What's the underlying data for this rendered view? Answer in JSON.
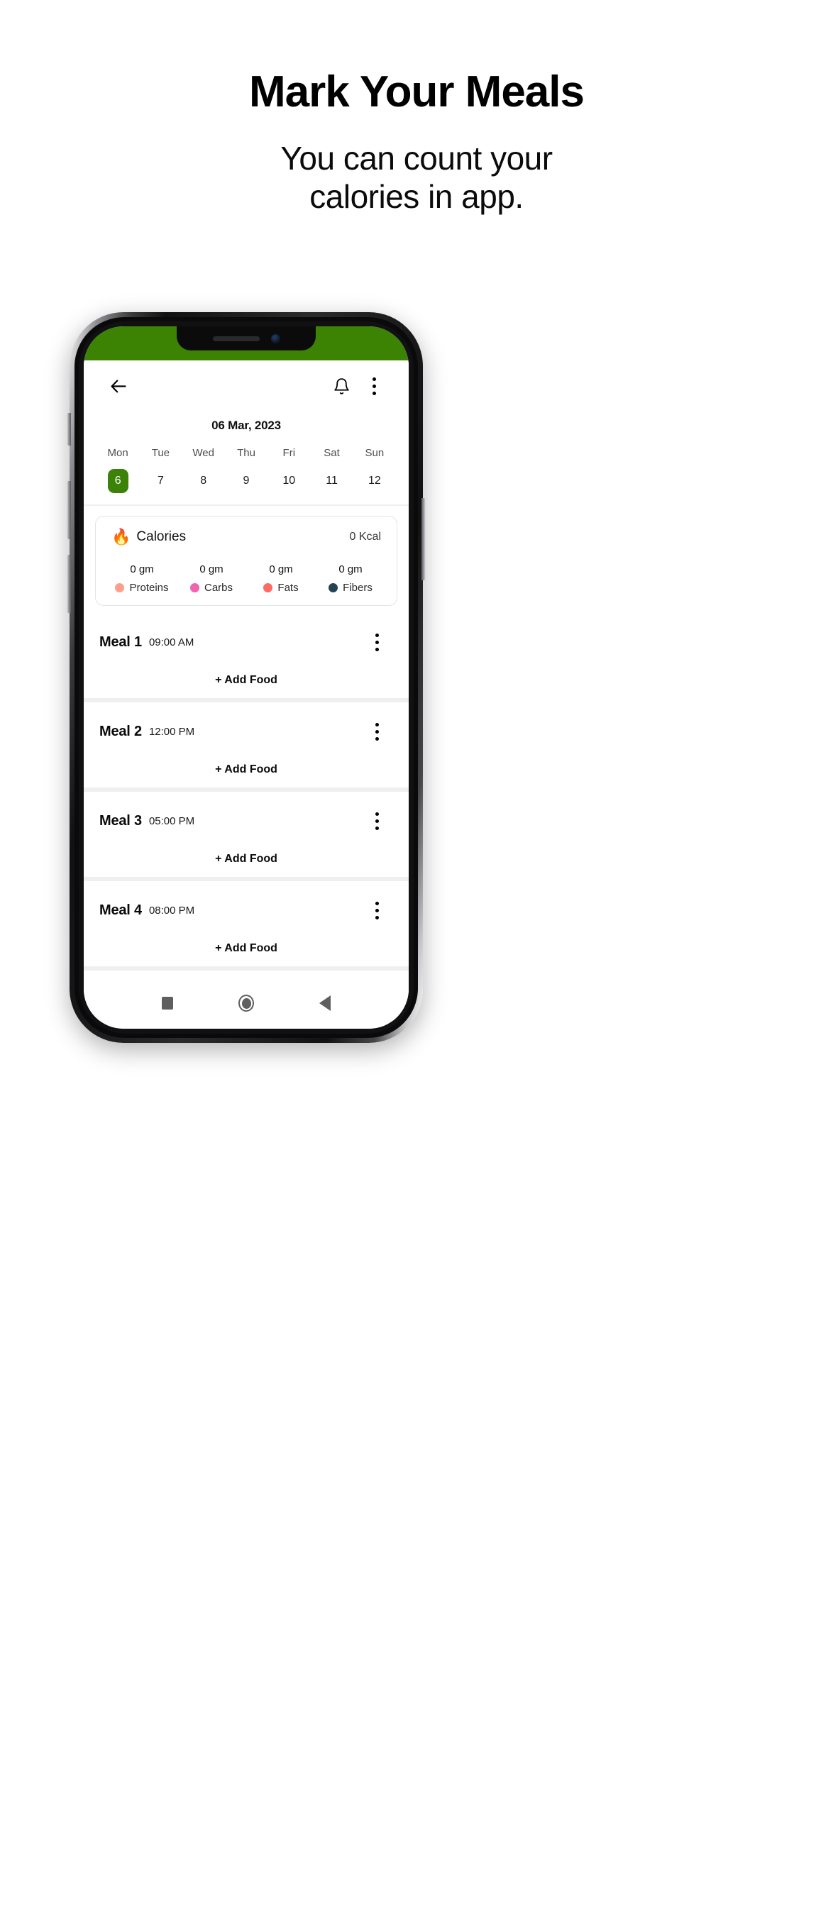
{
  "promo": {
    "title": "Mark Your Meals",
    "subtitle_line1": "You can count your",
    "subtitle_line2": "calories in app."
  },
  "phone": {
    "status_bar_color": "#3d8303"
  },
  "app_bar": {
    "back_icon": "arrow-left-icon",
    "notification_icon": "bell-icon",
    "overflow_icon": "more-vertical-icon"
  },
  "calendar": {
    "selected_date_label": "06 Mar, 2023",
    "weekdays": [
      "Mon",
      "Tue",
      "Wed",
      "Thu",
      "Fri",
      "Sat",
      "Sun"
    ],
    "dates": [
      "6",
      "7",
      "8",
      "9",
      "10",
      "11",
      "12"
    ],
    "selected_index": 0,
    "selected_color": "#3c8209"
  },
  "calories_card": {
    "icon": "fire-emoji",
    "icon_glyph": "🔥",
    "label": "Calories",
    "value": "0 Kcal",
    "macros": [
      {
        "amount": "0 gm",
        "name": "Proteins",
        "color": "#ff9e8a"
      },
      {
        "amount": "0 gm",
        "name": "Carbs",
        "color": "#ef64ac"
      },
      {
        "amount": "0 gm",
        "name": "Fats",
        "color": "#fc6a64"
      },
      {
        "amount": "0 gm",
        "name": "Fibers",
        "color": "#244354"
      }
    ]
  },
  "meals": [
    {
      "name": "Meal 1",
      "time": "09:00 AM",
      "add_label": "+ Add Food",
      "menu_icon": "more-vertical-icon"
    },
    {
      "name": "Meal 2",
      "time": "12:00 PM",
      "add_label": "+ Add Food",
      "menu_icon": "more-vertical-icon"
    },
    {
      "name": "Meal 3",
      "time": "05:00 PM",
      "add_label": "+ Add Food",
      "menu_icon": "more-vertical-icon"
    },
    {
      "name": "Meal 4",
      "time": "08:00 PM",
      "add_label": "+ Add Food",
      "menu_icon": "more-vertical-icon"
    }
  ],
  "android_nav": {
    "recents_icon": "square-recents-icon",
    "home_icon": "circle-home-icon",
    "back_icon": "triangle-back-icon"
  }
}
